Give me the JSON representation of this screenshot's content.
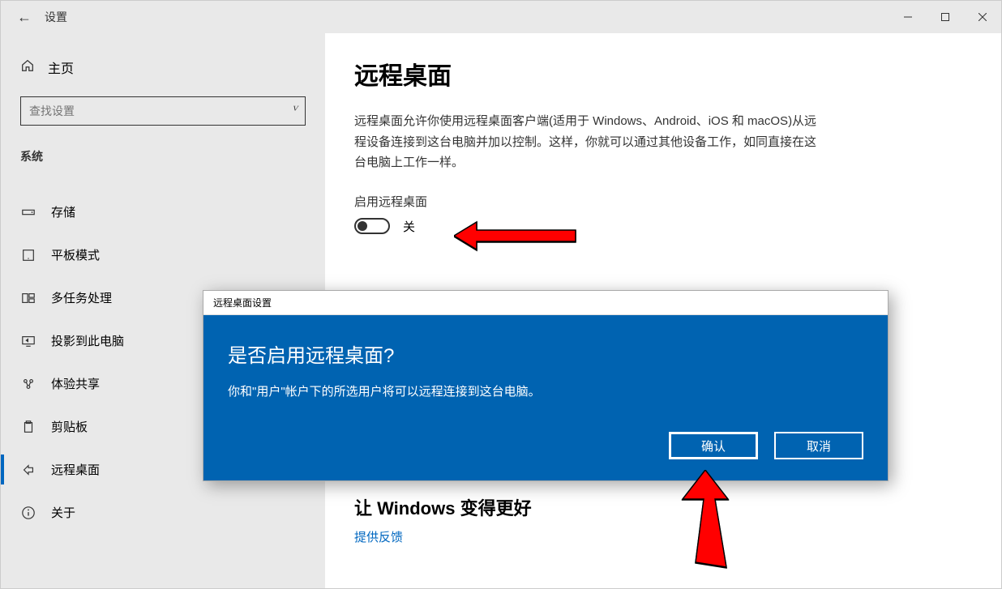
{
  "window": {
    "title": "设置"
  },
  "sidebar": {
    "home_label": "主页",
    "search_placeholder": "查找设置",
    "category": "系统",
    "items": [
      {
        "icon": "storage",
        "label": "存储"
      },
      {
        "icon": "tablet",
        "label": "平板模式"
      },
      {
        "icon": "multitask",
        "label": "多任务处理"
      },
      {
        "icon": "project",
        "label": "投影到此电脑"
      },
      {
        "icon": "share",
        "label": "体验共享"
      },
      {
        "icon": "clipboard",
        "label": "剪贴板"
      },
      {
        "icon": "remote",
        "label": "远程桌面",
        "active": true
      },
      {
        "icon": "about",
        "label": "关于"
      }
    ]
  },
  "main": {
    "title": "远程桌面",
    "description": "远程桌面允许你使用远程桌面客户端(适用于 Windows、Android、iOS 和 macOS)从远程设备连接到这台电脑并加以控制。这样，你就可以通过其他设备工作，如同直接在这台电脑上工作一样。",
    "enable_label": "启用远程桌面",
    "toggle_state": "关",
    "improve_title": "让 Windows 变得更好",
    "feedback_link": "提供反馈"
  },
  "dialog": {
    "header": "远程桌面设置",
    "title": "是否启用远程桌面?",
    "text": "你和\"用户\"帐户下的所选用户将可以远程连接到这台电脑。",
    "confirm": "确认",
    "cancel": "取消"
  },
  "colors": {
    "accent": "#0063b1",
    "link": "#0067c0",
    "arrow": "#ff0000"
  }
}
